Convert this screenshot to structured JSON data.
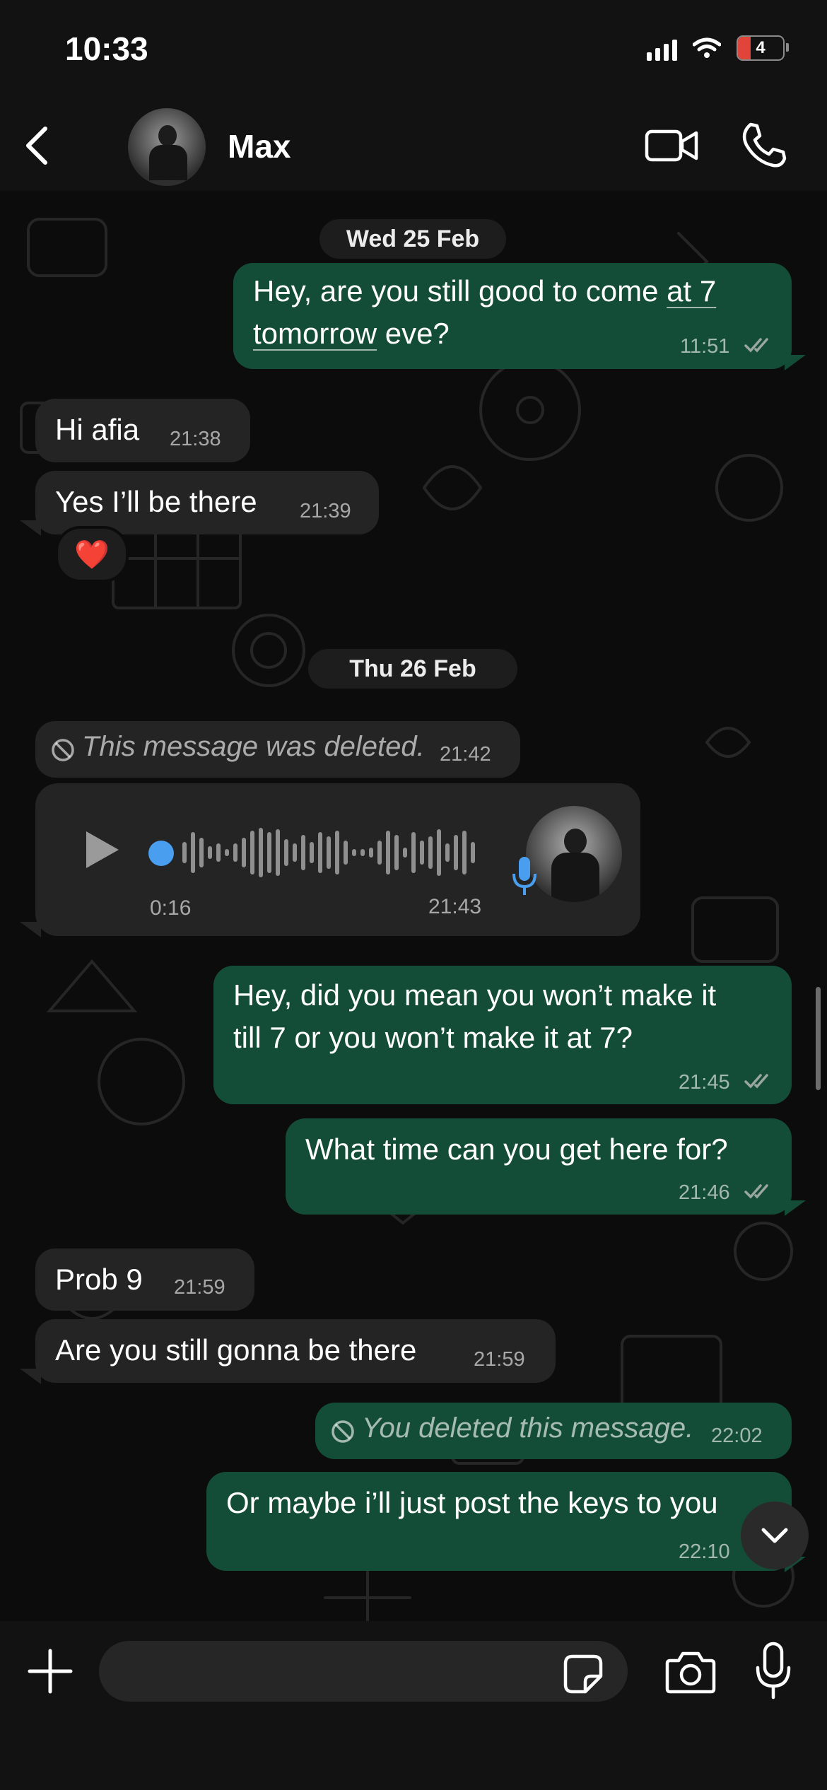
{
  "status_bar": {
    "time": "10:33",
    "battery": "4"
  },
  "header": {
    "contact_name": "Max"
  },
  "dates": [
    "Wed 25 Feb",
    "Thu 26 Feb"
  ],
  "messages": [
    {
      "dir": "out",
      "parts": [
        "Hey, are you still good to come ",
        "at 7",
        "tomorrow",
        " eve?"
      ],
      "time": "11:51"
    },
    {
      "dir": "in",
      "text": "Hi afia",
      "time": "21:38"
    },
    {
      "dir": "in",
      "text": "Yes I’ll be there",
      "time": "21:39",
      "reaction": "❤️"
    },
    {
      "dir": "in",
      "deleted": true,
      "text": "This message was deleted.",
      "time": "21:42"
    },
    {
      "dir": "in",
      "voice": true,
      "duration": "0:16",
      "time": "21:43"
    },
    {
      "dir": "out",
      "line1": "Hey, did you mean you won’t make it",
      "line2": "till 7 or you won’t make it at 7?",
      "time": "21:45"
    },
    {
      "dir": "out",
      "text": "What time can you get here for?",
      "time": "21:46"
    },
    {
      "dir": "in",
      "text": "Prob 9",
      "time": "21:59"
    },
    {
      "dir": "in",
      "text": "Are you still gonna be there",
      "time": "21:59"
    },
    {
      "dir": "out",
      "deleted": true,
      "text": "You deleted this message.",
      "time": "22:02"
    },
    {
      "dir": "out",
      "text": "Or maybe i’ll just post the keys to you",
      "time": "22:10"
    }
  ],
  "composer": {
    "placeholder": ""
  },
  "colors": {
    "outgoing_bubble": "#144d37",
    "incoming_bubble": "#242424",
    "voice_dot": "#4a9eef",
    "read_ticks": "#9aa7a0"
  },
  "icons": [
    "back-chevron-icon",
    "video-call-icon",
    "phone-icon",
    "play-icon",
    "microphone-icon",
    "plus-icon",
    "sticker-icon",
    "camera-icon",
    "chevron-down-icon",
    "blocked-icon",
    "double-check-icon"
  ]
}
